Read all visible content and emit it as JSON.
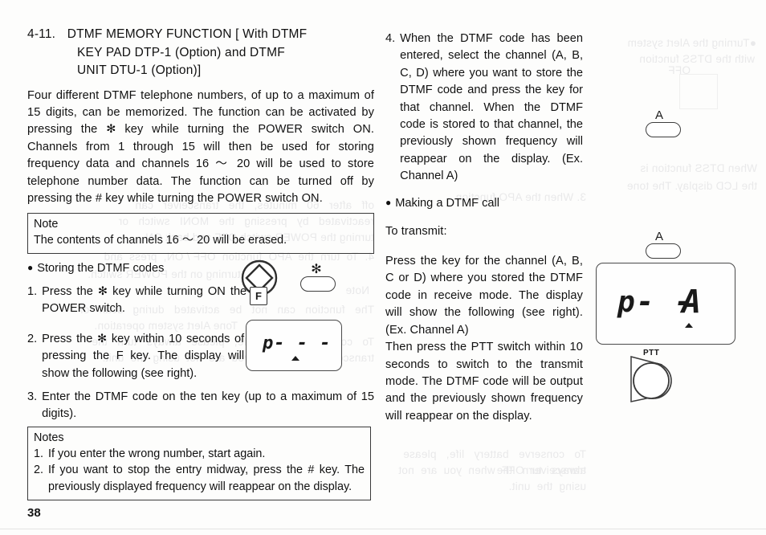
{
  "page": {
    "number": "38"
  },
  "left": {
    "heading": {
      "number": "4-11.",
      "line1": "DTMF   MEMORY   FUNCTION   [ With   DTMF",
      "line2": "KEY    PAD    DTP-1   (Option)    and     DTMF",
      "line3": "UNIT DTU-1 (Option)]"
    },
    "intro": "Four different DTMF telephone numbers, of up to a maximum of 15 digits, can be memorized. The function can be activated by pressing the ✻ key while turning the POWER switch ON. Channels from 1 through 15 will then be used for storing frequency data and channels 16 〜 20 will be used to store telephone number data. The function can be turned off by pressing the # key while turning the POWER switch ON.",
    "note_box": {
      "title": "Note",
      "line": "The contents of channels 16 〜 20 will be erased."
    },
    "bullet": {
      "dot": "●",
      "label": "Storing the DTMF codes"
    },
    "steps": [
      {
        "num": "1.",
        "text": "Press the ✻ key while turning ON the POWER switch."
      },
      {
        "num": "2.",
        "text": "Press the ✻ key within 10 seconds of pressing the F key. The display will show the following (see right)."
      },
      {
        "num": "3.",
        "text": "Enter the DTMF code on the ten key (up to a maximum of 15 digits)."
      }
    ],
    "notes_box": {
      "title": "Notes",
      "items": [
        {
          "num": "1.",
          "text": "If you enter the wrong number, start again."
        },
        {
          "num": "2.",
          "text": "If you want to stop the entry midway, press the # key. The previously displayed frequency will reappear on the display."
        }
      ]
    },
    "art": {
      "power_knob_name": "power-switch-knob",
      "f_key_label": "F",
      "star_key_label": "✻",
      "lcd_text": "p- - -"
    }
  },
  "middle": {
    "step4": {
      "num": "4.",
      "text": "When the DTMF code has been entered, select the channel (A, B, C, D) where you want to store the DTMF code and press the key for that channel. When the DTMF code is stored to that channel, the previously shown frequency will reappear on the display. (Ex. Channel A)"
    },
    "bullet": {
      "dot": "●",
      "label": "Making a DTMF call"
    },
    "to_transmit": "To transmit:",
    "para1": "Press the key for the channel (A, B, C or D) where you stored the DTMF code in receive mode. The display will show the following (see right). (Ex. Channel A)",
    "para2": "Then press the PTT switch within 10 seconds to switch to the transmit mode. The DTMF code will be output and the previously shown frequency will reappear on the display."
  },
  "right": {
    "channel_key_top": {
      "label": "A"
    },
    "channel_key_bottom": {
      "label": "A"
    },
    "lcd": {
      "text": "p- -",
      "channel_char": "A"
    },
    "ptt": {
      "label": "PTT"
    }
  },
  "bleed": {
    "t1": "●Turning the Alert system",
    "t2": "with the DTSS function",
    "t3": "OFF",
    "t4": "When DTSS function is",
    "t5": "the LCD display. The tone",
    "t6": "3. When the APO function",
    "t7": "off   after   60   minutes,   the   transceiver   can",
    "t8": "reactivated   by   pressing   the   MONI   switch   or",
    "t9": "turning the POWER switch OFF and back ON.",
    "t10": "4.  To  turn  the  APO  function  OFF / ON,  press  and",
    "t11": "while turning on the POWER switch.",
    "t12": "Note",
    "t13": "The   function   can   not   be   activated   during   scan   or",
    "t14": "Tone Alert system operation.",
    "t15": "To   conserve   battery   life,   please   always   turn   the",
    "t16": "transceiver  OFF  when  you  are  not  using  the  unit."
  }
}
